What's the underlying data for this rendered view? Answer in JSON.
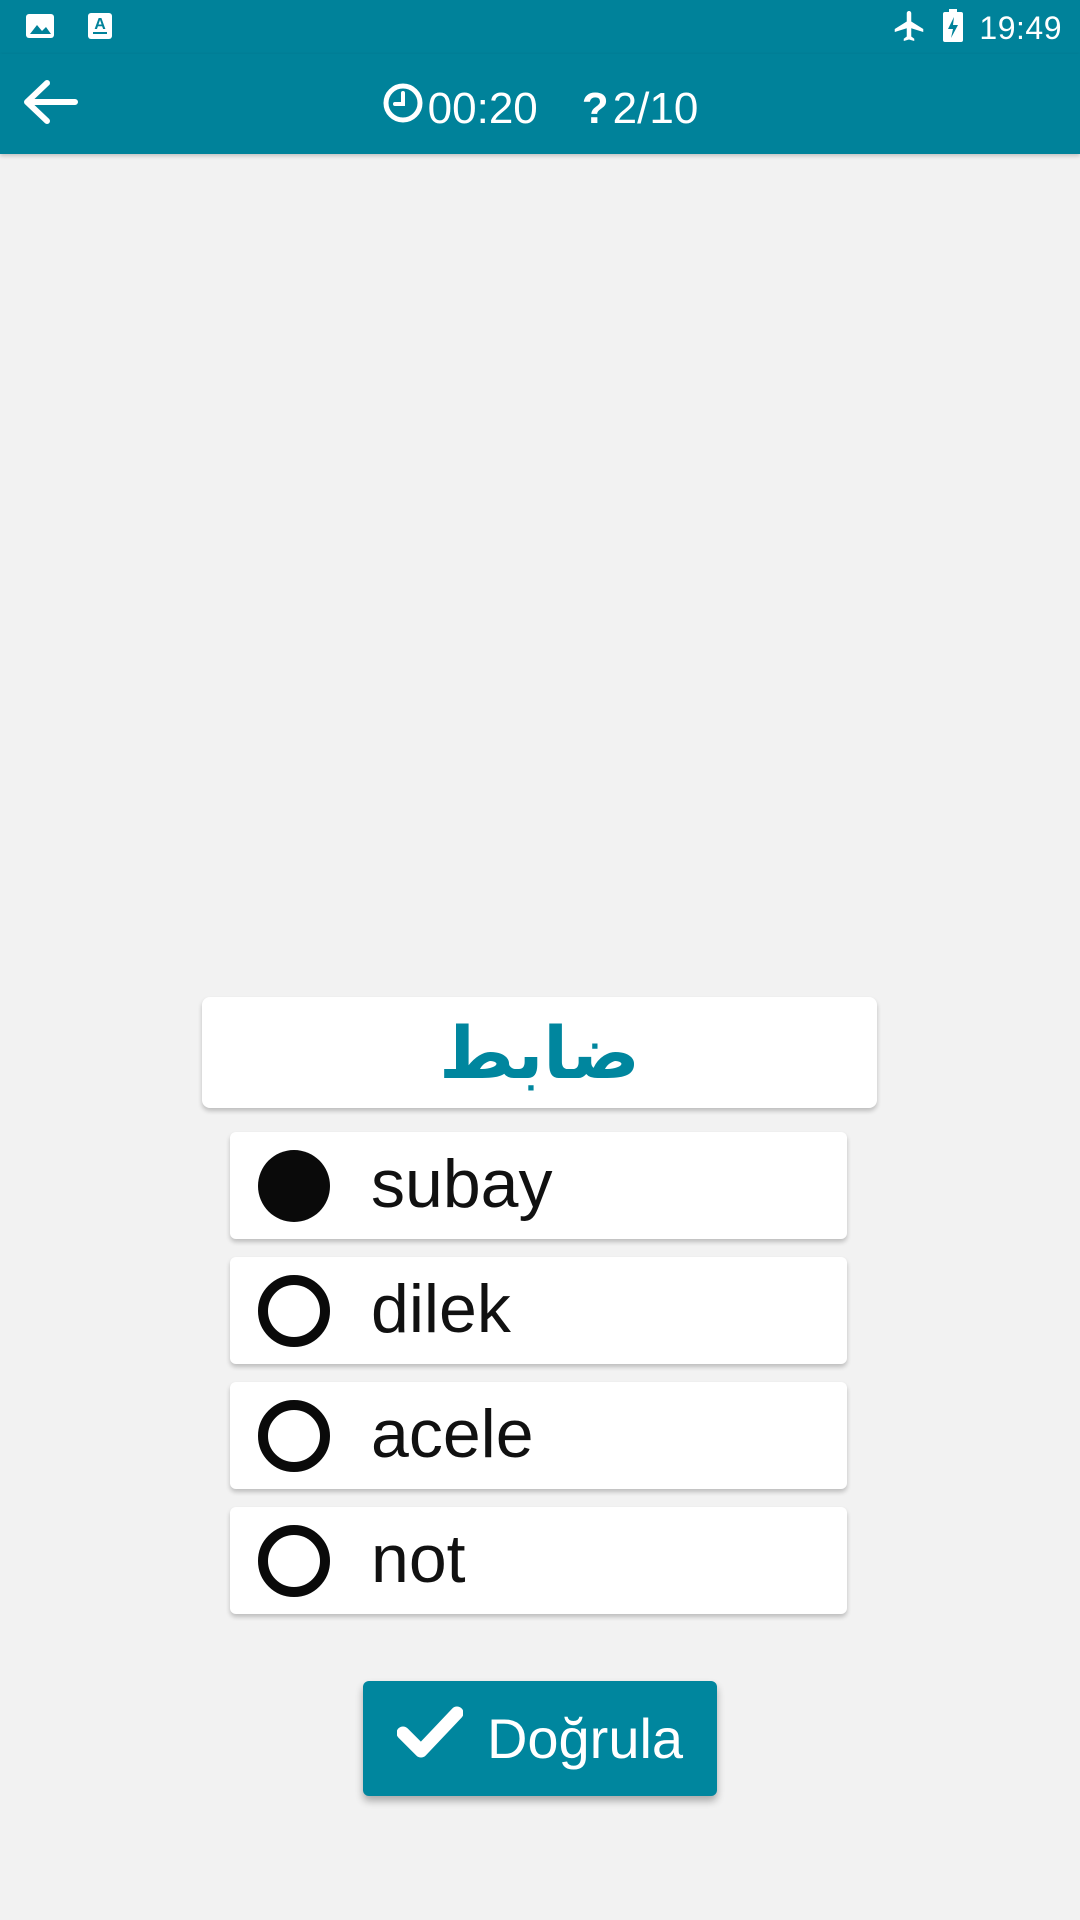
{
  "status_bar": {
    "time": "19:49",
    "left_icons": [
      "image-icon",
      "text-a-icon"
    ],
    "right_icons": [
      "airplane-icon",
      "battery-charging-icon"
    ]
  },
  "app_bar": {
    "back_icon": "back-arrow-icon",
    "timer": "00:20",
    "progress": "2/10"
  },
  "question": {
    "word": "ضابط"
  },
  "options": [
    {
      "label": "subay",
      "selected": true
    },
    {
      "label": "dilek",
      "selected": false
    },
    {
      "label": "acele",
      "selected": false
    },
    {
      "label": "not",
      "selected": false
    }
  ],
  "verify_button": {
    "label": "Doğrula"
  },
  "colors": {
    "primary": "#00829a",
    "word": "#00869e",
    "background": "#f2f2f2"
  }
}
